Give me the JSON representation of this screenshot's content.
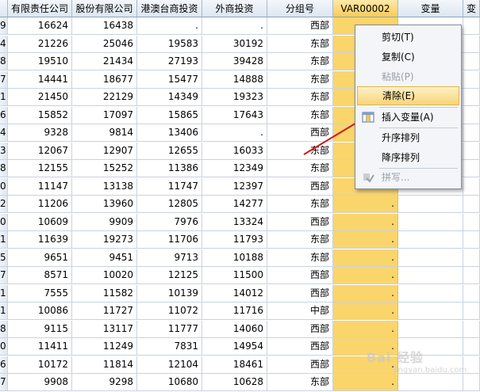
{
  "columns": {
    "c0": "",
    "c1": "有限责任公司",
    "c2": "股份有限公司",
    "c3": "港澳台商投资",
    "c4": "外商投资",
    "c5": "分组号",
    "c6": "VAR00002",
    "c7": "变量",
    "c8": "变"
  },
  "rows": [
    {
      "rn": "9",
      "a": "16624",
      "b": "16438",
      "c": ".",
      "d": ".",
      "g": "西部",
      "v": "."
    },
    {
      "rn": "4",
      "a": "21226",
      "b": "25046",
      "c": "19583",
      "d": "30192",
      "g": "东部",
      "v": "."
    },
    {
      "rn": "8",
      "a": "19510",
      "b": "21434",
      "c": "27193",
      "d": "39428",
      "g": "东部",
      "v": "."
    },
    {
      "rn": "7",
      "a": "14441",
      "b": "18677",
      "c": "15477",
      "d": "14888",
      "g": "东部",
      "v": "."
    },
    {
      "rn": "1",
      "a": "21450",
      "b": "22129",
      "c": "14349",
      "d": "19323",
      "g": "东部",
      "v": "."
    },
    {
      "rn": "6",
      "a": "15852",
      "b": "17097",
      "c": "15865",
      "d": "17643",
      "g": "东部",
      "v": "."
    },
    {
      "rn": "4",
      "a": "9328",
      "b": "9814",
      "c": "13406",
      "d": ".",
      "g": "西部",
      "v": "."
    },
    {
      "rn": "3",
      "a": "12067",
      "b": "12907",
      "c": "12655",
      "d": "16033",
      "g": "东部",
      "v": "."
    },
    {
      "rn": "8",
      "a": "12155",
      "b": "15252",
      "c": "11386",
      "d": "12349",
      "g": "东部",
      "v": "."
    },
    {
      "rn": "0",
      "a": "11147",
      "b": "13138",
      "c": "11747",
      "d": "12397",
      "g": "西部",
      "v": "."
    },
    {
      "rn": "2",
      "a": "11206",
      "b": "13960",
      "c": "12805",
      "d": "14277",
      "g": "东部",
      "v": "."
    },
    {
      "rn": "0",
      "a": "10609",
      "b": "9909",
      "c": "7976",
      "d": "13324",
      "g": "西部",
      "v": "."
    },
    {
      "rn": "1",
      "a": "11639",
      "b": "19273",
      "c": "11706",
      "d": "11793",
      "g": "东部",
      "v": "."
    },
    {
      "rn": "5",
      "a": "9651",
      "b": "9451",
      "c": "9713",
      "d": "10188",
      "g": "东部",
      "v": "."
    },
    {
      "rn": "7",
      "a": "8571",
      "b": "10020",
      "c": "12125",
      "d": "11500",
      "g": "西部",
      "v": "."
    },
    {
      "rn": "1",
      "a": "7555",
      "b": "11582",
      "c": "10139",
      "d": "14012",
      "g": "西部",
      "v": "."
    },
    {
      "rn": "1",
      "a": "10086",
      "b": "11727",
      "c": "11072",
      "d": "11716",
      "g": "中部",
      "v": "."
    },
    {
      "rn": "8",
      "a": "9115",
      "b": "13117",
      "c": "11777",
      "d": "14060",
      "g": "西部",
      "v": "."
    },
    {
      "rn": "0",
      "a": "11411",
      "b": "11249",
      "c": "7831",
      "d": "14954",
      "g": "西部",
      "v": "."
    },
    {
      "rn": "6",
      "a": "10172",
      "b": "11814",
      "c": "12104",
      "d": "18461",
      "g": "西部",
      "v": "."
    },
    {
      "rn": "7",
      "a": "9908",
      "b": "9298",
      "c": "10680",
      "d": "10628",
      "g": "东部",
      "v": "."
    }
  ],
  "menu": {
    "cut": "剪切(T)",
    "copy": "复制(C)",
    "paste": "粘贴(P)",
    "clear": "清除(E)",
    "insert_variable": "插入变量(A)",
    "sort_asc": "升序排列",
    "sort_desc": "降序排列",
    "spelling": "拼写..."
  },
  "watermark": {
    "main": "Bai 经验",
    "sub": "jingyan.baidu.com"
  },
  "colors": {
    "selection": "#f9d56b",
    "menu_highlight": "#f7d57a",
    "arrow": "#d01a1a"
  }
}
